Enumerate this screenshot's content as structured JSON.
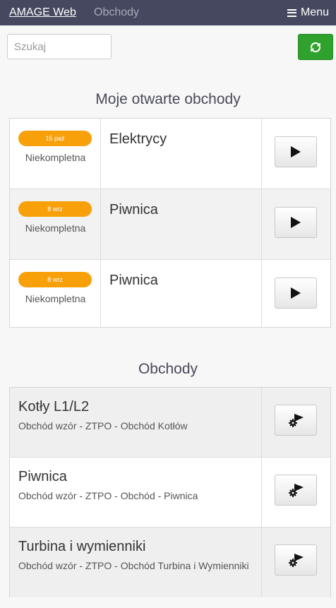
{
  "nav": {
    "brand": "AMAGE Web",
    "link": "Obchody",
    "menu": "Menu"
  },
  "search": {
    "placeholder": "Szukaj",
    "value": ""
  },
  "icons": {
    "refresh": "refresh-icon",
    "play": "play-icon",
    "start_with_settings": "play-gear-icon",
    "menu": "hamburger-icon"
  },
  "colors": {
    "navbar": "#46485f",
    "accent_green": "#2fa12d",
    "badge_orange": "#f8a00a"
  },
  "open_rounds": {
    "title": "Moje otwarte obchody",
    "items": [
      {
        "date": "15 paź",
        "status": "Niekompletna",
        "name": "Elektrycy"
      },
      {
        "date": "8 wrz",
        "status": "Niekompletna",
        "name": "Piwnica"
      },
      {
        "date": "8 wrz",
        "status": "Niekompletna",
        "name": "Piwnica"
      }
    ]
  },
  "rounds": {
    "title": "Obchody",
    "items": [
      {
        "name": "Kotły L1/L2",
        "description": "Obchód wzór - ZTPO - Obchód Kotłów"
      },
      {
        "name": "Piwnica",
        "description": "Obchód wzór - ZTPO - Obchód - Piwnica"
      },
      {
        "name": "Turbina i wymienniki",
        "description": "Obchód wzór - ZTPO - Obchód Turbina i Wymienniki"
      }
    ]
  }
}
